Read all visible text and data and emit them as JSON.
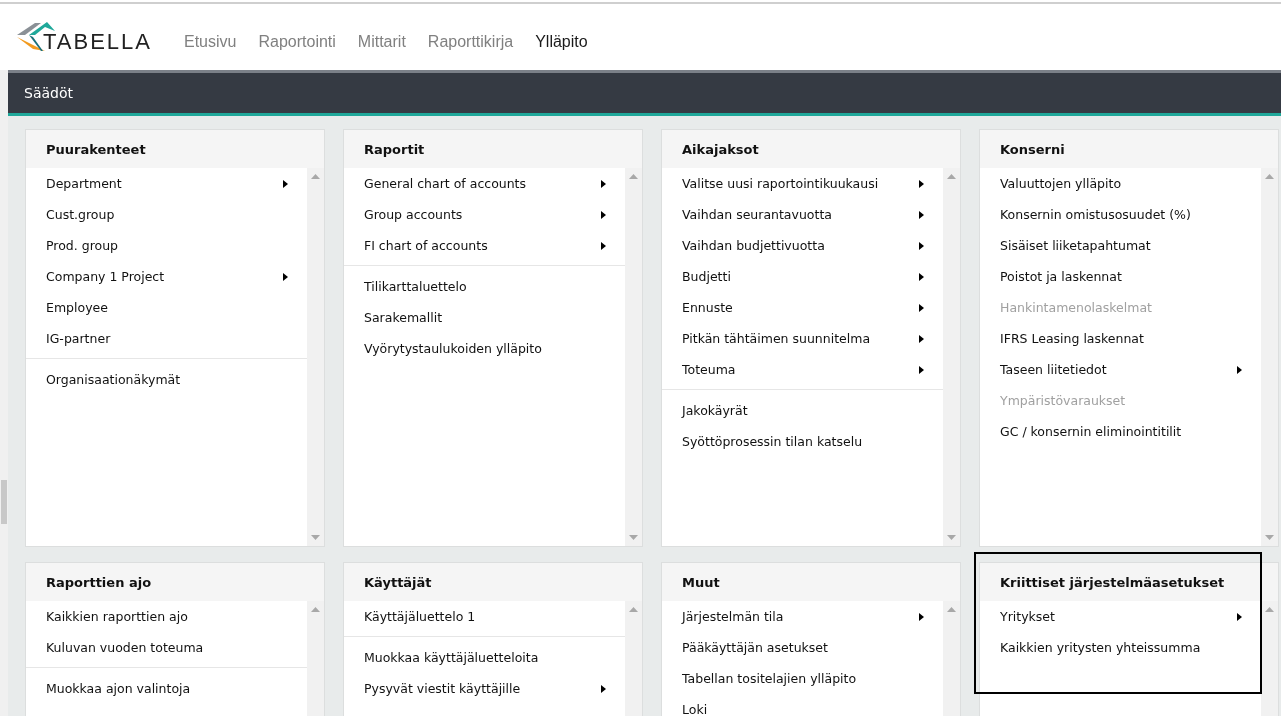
{
  "logo": {
    "text": "TABELLA"
  },
  "nav": [
    {
      "label": "Etusivu",
      "selected": false
    },
    {
      "label": "Raportointi",
      "selected": false
    },
    {
      "label": "Mittarit",
      "selected": false
    },
    {
      "label": "Raporttikirja",
      "selected": false
    },
    {
      "label": "Ylläpito",
      "selected": true
    }
  ],
  "section_bar": {
    "title": "Säädöt"
  },
  "panels": [
    {
      "title": "Puurakenteet",
      "highlighted": false,
      "groups": [
        [
          {
            "label": "Department",
            "submenu": true,
            "disabled": false
          },
          {
            "label": "Cust.group",
            "submenu": false,
            "disabled": false
          },
          {
            "label": "Prod. group",
            "submenu": false,
            "disabled": false
          },
          {
            "label": "Company 1 Project",
            "submenu": true,
            "disabled": false
          },
          {
            "label": "Employee",
            "submenu": false,
            "disabled": false
          },
          {
            "label": "IG-partner",
            "submenu": false,
            "disabled": false
          }
        ],
        [
          {
            "label": "Organisaationäkymät",
            "submenu": false,
            "disabled": false
          }
        ]
      ]
    },
    {
      "title": "Raportit",
      "highlighted": false,
      "groups": [
        [
          {
            "label": "General chart of accounts",
            "submenu": true,
            "disabled": false
          },
          {
            "label": "Group accounts",
            "submenu": true,
            "disabled": false
          },
          {
            "label": "FI chart of accounts",
            "submenu": true,
            "disabled": false
          }
        ],
        [
          {
            "label": "Tilikarttaluettelo",
            "submenu": false,
            "disabled": false
          },
          {
            "label": "Sarakemallit",
            "submenu": false,
            "disabled": false
          },
          {
            "label": "Vyörytystaulukoiden ylläpito",
            "submenu": false,
            "disabled": false
          }
        ]
      ]
    },
    {
      "title": "Aikajaksot",
      "highlighted": false,
      "groups": [
        [
          {
            "label": "Valitse uusi raportointikuukausi",
            "submenu": true,
            "disabled": false
          },
          {
            "label": "Vaihdan seurantavuotta",
            "submenu": true,
            "disabled": false
          },
          {
            "label": "Vaihdan budjettivuotta",
            "submenu": true,
            "disabled": false
          },
          {
            "label": "Budjetti",
            "submenu": true,
            "disabled": false
          },
          {
            "label": "Ennuste",
            "submenu": true,
            "disabled": false
          },
          {
            "label": "Pitkän tähtäimen suunnitelma",
            "submenu": true,
            "disabled": false
          },
          {
            "label": "Toteuma",
            "submenu": true,
            "disabled": false
          }
        ],
        [
          {
            "label": "Jakokäyrät",
            "submenu": false,
            "disabled": false
          },
          {
            "label": "Syöttöprosessin tilan katselu",
            "submenu": false,
            "disabled": false
          }
        ]
      ]
    },
    {
      "title": "Konserni",
      "highlighted": false,
      "groups": [
        [
          {
            "label": "Valuuttojen ylläpito",
            "submenu": false,
            "disabled": false
          },
          {
            "label": "Konsernin omistusosuudet (%)",
            "submenu": false,
            "disabled": false
          },
          {
            "label": "Sisäiset liiketapahtumat",
            "submenu": false,
            "disabled": false
          },
          {
            "label": "Poistot ja laskennat",
            "submenu": false,
            "disabled": false
          },
          {
            "label": "Hankintamenolaskelmat",
            "submenu": false,
            "disabled": true
          },
          {
            "label": "IFRS Leasing laskennat",
            "submenu": false,
            "disabled": false
          },
          {
            "label": "Taseen liitetiedot",
            "submenu": true,
            "disabled": false
          },
          {
            "label": "Ympäristövaraukset",
            "submenu": false,
            "disabled": true
          },
          {
            "label": "GC / konsernin eliminointitilit",
            "submenu": false,
            "disabled": false
          }
        ]
      ]
    },
    {
      "title": "Raporttien ajo",
      "highlighted": false,
      "groups": [
        [
          {
            "label": "Kaikkien raporttien ajo",
            "submenu": false,
            "disabled": false
          },
          {
            "label": "Kuluvan vuoden toteuma",
            "submenu": false,
            "disabled": false
          }
        ],
        [
          {
            "label": "Muokkaa ajon valintoja",
            "submenu": false,
            "disabled": false
          }
        ]
      ]
    },
    {
      "title": "Käyttäjät",
      "highlighted": false,
      "groups": [
        [
          {
            "label": "Käyttäjäluettelo 1",
            "submenu": false,
            "disabled": false
          }
        ],
        [
          {
            "label": "Muokkaa käyttäjäluetteloita",
            "submenu": false,
            "disabled": false
          },
          {
            "label": "Pysyvät viestit käyttäjille",
            "submenu": true,
            "disabled": false
          }
        ]
      ]
    },
    {
      "title": "Muut",
      "highlighted": false,
      "groups": [
        [
          {
            "label": "Järjestelmän tila",
            "submenu": true,
            "disabled": false
          },
          {
            "label": "Pääkäyttäjän asetukset",
            "submenu": false,
            "disabled": false
          },
          {
            "label": "Tabellan tositelajien ylläpito",
            "submenu": false,
            "disabled": false
          },
          {
            "label": "Loki",
            "submenu": false,
            "disabled": false
          }
        ]
      ]
    },
    {
      "title": "Kriittiset järjestelmäasetukset",
      "highlighted": true,
      "groups": [
        [
          {
            "label": "Yritykset",
            "submenu": true,
            "disabled": false
          },
          {
            "label": "Kaikkien yritysten yhteissumma",
            "submenu": false,
            "disabled": false
          }
        ]
      ]
    }
  ]
}
